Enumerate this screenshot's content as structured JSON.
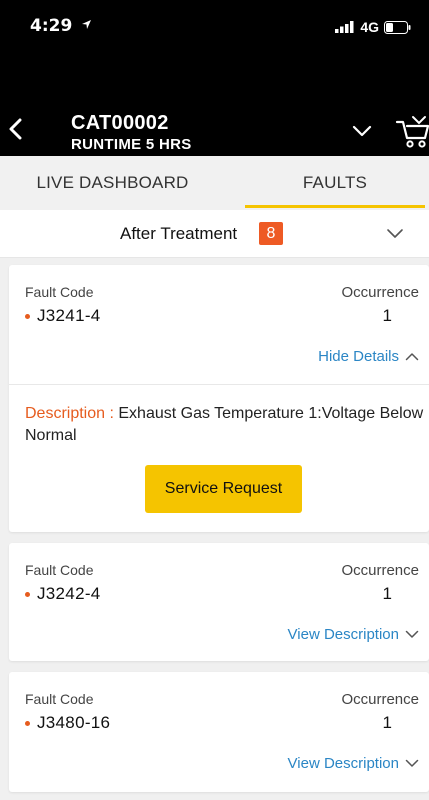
{
  "status_bar": {
    "time": "4:29",
    "network": "4G"
  },
  "header": {
    "title": "CAT00002",
    "subtitle": "RUNTIME 5 HRS"
  },
  "tabs": [
    {
      "label": "LIVE DASHBOARD",
      "active": false
    },
    {
      "label": "FAULTS",
      "active": true
    }
  ],
  "filter": {
    "label": "After Treatment",
    "count": "8"
  },
  "colors": {
    "accent": "#f5c400",
    "badge": "#ee5a24",
    "link": "#2b86c5",
    "dot": "#e65c1f"
  },
  "faults": [
    {
      "code_label": "Fault Code",
      "occurrence_label": "Occurrence",
      "code": "J3241-4",
      "occurrence": "1",
      "toggle_label": "Hide Details",
      "description_label": "Description :",
      "description": "Exhaust Gas Temperature 1:Voltage Below Normal",
      "action_label": "Service Request"
    },
    {
      "code_label": "Fault Code",
      "occurrence_label": "Occurrence",
      "code": "J3242-4",
      "occurrence": "1",
      "toggle_label": "View Description"
    },
    {
      "code_label": "Fault Code",
      "occurrence_label": "Occurrence",
      "code": "J3480-16",
      "occurrence": "1",
      "toggle_label": "View Description"
    }
  ]
}
